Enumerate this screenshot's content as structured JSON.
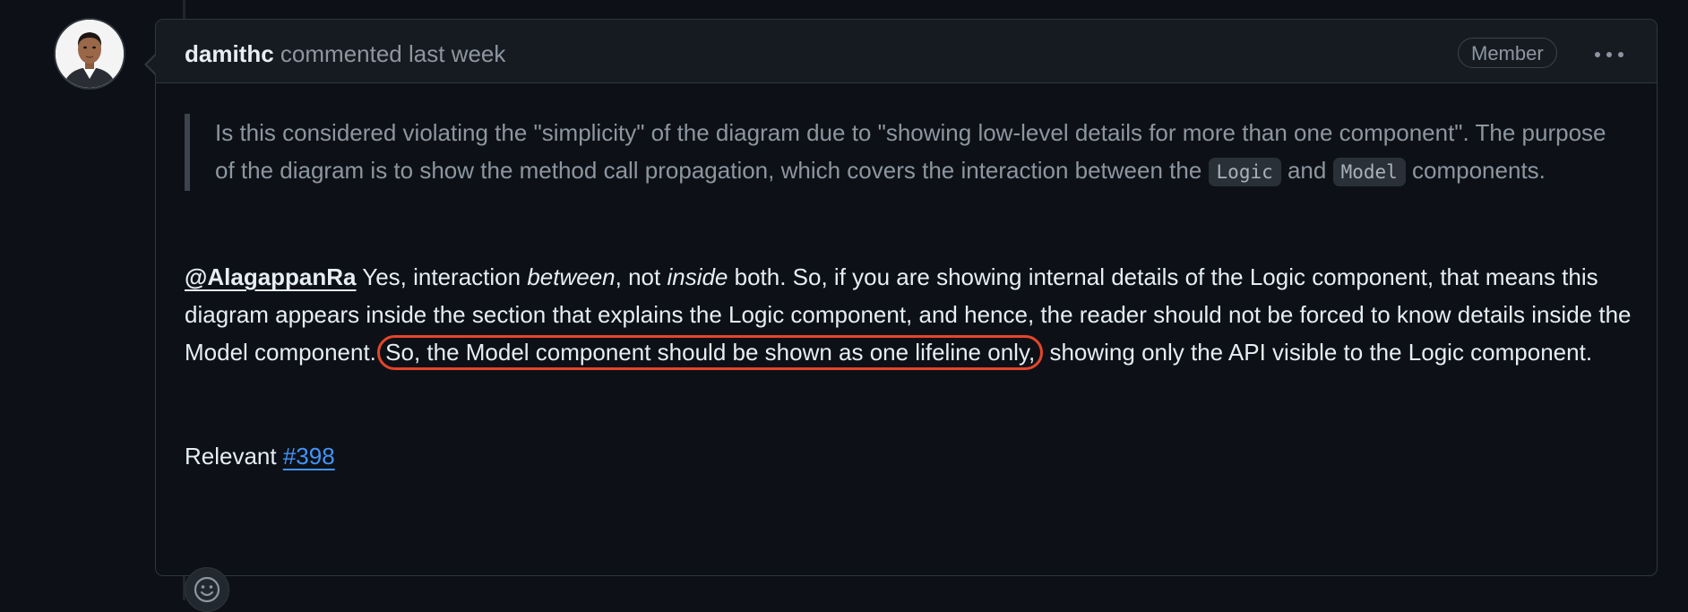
{
  "comment": {
    "author": "damithc",
    "meta": "commented last week",
    "role_badge": "Member",
    "more_icon": "kebab-horizontal-icon"
  },
  "quote": {
    "part1": "Is this considered violating the \"simplicity\" of the diagram due to \"showing low-level details for more than one component\". The purpose of the diagram is to show the method call propagation, which covers the interaction between the ",
    "code1": "Logic",
    "part2": " and ",
    "code2": "Model",
    "part3": " components."
  },
  "reply": {
    "mention": "@AlagappanRa",
    "text1": " Yes, interaction ",
    "em1": "between",
    "text2": ", not ",
    "em2": "inside",
    "text3": " both. So, if you are showing internal details of the Logic component, that means this diagram appears inside the section that explains the Logic component, and hence, the reader should not be forced to know details inside the Model component. ",
    "highlighted": "So, the Model component should be shown as one lifeline only,",
    "text4": " showing only the API visible to the Logic component."
  },
  "relevant": {
    "label": "Relevant ",
    "link": "#398"
  },
  "reaction": {
    "icon": "smiley-icon"
  },
  "colors": {
    "background": "#0d1117",
    "header_bg": "#161b22",
    "border": "#30363d",
    "muted_text": "#8d96a0",
    "link": "#4493f8",
    "highlight_ring": "#e5452b"
  }
}
